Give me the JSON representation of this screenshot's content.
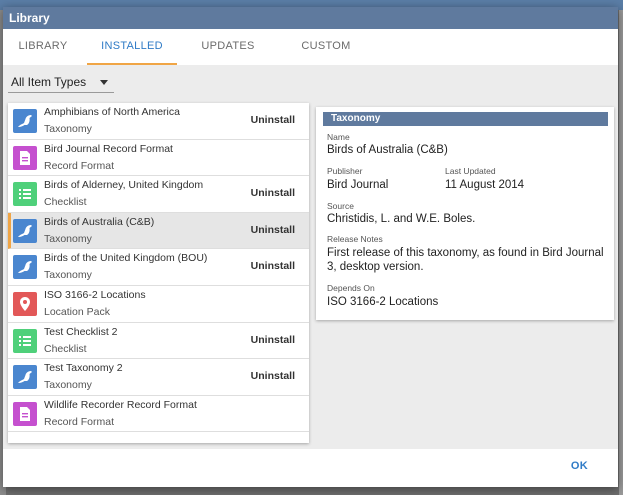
{
  "window": {
    "title": "Library"
  },
  "tabs": [
    {
      "label": "LIBRARY"
    },
    {
      "label": "INSTALLED"
    },
    {
      "label": "UPDATES"
    },
    {
      "label": "CUSTOM"
    }
  ],
  "active_tab": "INSTALLED",
  "filter": {
    "selected": "All Item Types"
  },
  "items": [
    {
      "name": "Amphibians of North America",
      "type": "Taxonomy",
      "icon": "bird-icon",
      "action": "Uninstall"
    },
    {
      "name": "Bird Journal Record Format",
      "type": "Record Format",
      "icon": "document-icon",
      "action": ""
    },
    {
      "name": "Birds of Alderney, United Kingdom",
      "type": "Checklist",
      "icon": "list-icon",
      "action": "Uninstall"
    },
    {
      "name": "Birds of Australia (C&B)",
      "type": "Taxonomy",
      "icon": "bird-icon",
      "action": "Uninstall",
      "selected": true
    },
    {
      "name": "Birds of the United Kingdom (BOU)",
      "type": "Taxonomy",
      "icon": "bird-icon",
      "action": "Uninstall"
    },
    {
      "name": "ISO 3166-2 Locations",
      "type": "Location Pack",
      "icon": "location-pin-icon",
      "action": ""
    },
    {
      "name": "Test Checklist 2",
      "type": "Checklist",
      "icon": "list-icon",
      "action": "Uninstall"
    },
    {
      "name": "Test Taxonomy 2",
      "type": "Taxonomy",
      "icon": "bird-icon",
      "action": "Uninstall"
    },
    {
      "name": "Wildlife Recorder Record Format",
      "type": "Record Format",
      "icon": "document-icon",
      "action": ""
    }
  ],
  "details": {
    "header": "Taxonomy",
    "name_label": "Name",
    "name": "Birds of Australia (C&B)",
    "publisher_label": "Publisher",
    "publisher": "Bird Journal",
    "updated_label": "Last Updated",
    "updated": "11 August 2014",
    "source_label": "Source",
    "source": "Christidis, L. and W.E. Boles.",
    "notes_label": "Release Notes",
    "notes": "First release of this taxonomy, as found in Bird Journal 3, desktop version.",
    "depends_label": "Depends On",
    "depends": "ISO 3166-2 Locations"
  },
  "footer": {
    "ok_label": "OK"
  },
  "colors": {
    "accent": "#2f7bc6",
    "tab_underline": "#f0a545",
    "titlebar": "#5f7a9e",
    "taxonomy_icon": "#4a86cf",
    "record_icon": "#c550cf",
    "checklist_icon": "#4fd07a",
    "location_icon": "#e25858"
  }
}
